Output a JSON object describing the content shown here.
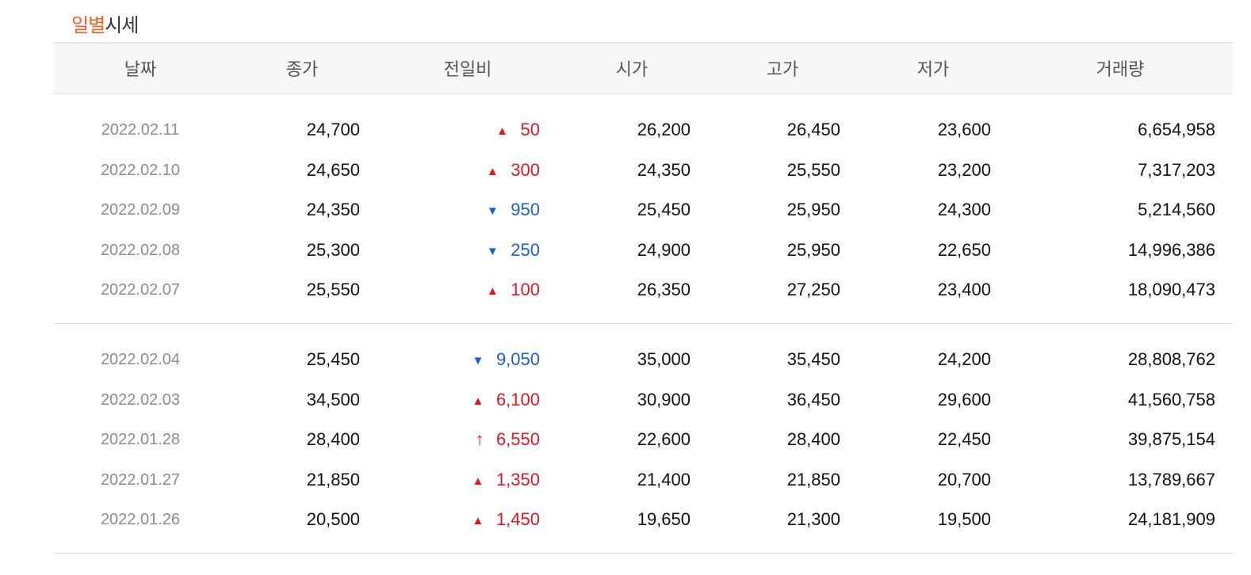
{
  "title": {
    "accent": "일별",
    "rest": "시세"
  },
  "columns": [
    "날짜",
    "종가",
    "전일비",
    "시가",
    "고가",
    "저가",
    "거래량"
  ],
  "groups": [
    [
      {
        "date": "2022.02.11",
        "close": "24,700",
        "dir": "up",
        "icon": "up-triangle-icon",
        "change": "50",
        "open": "26,200",
        "high": "26,450",
        "low": "23,600",
        "volume": "6,654,958"
      },
      {
        "date": "2022.02.10",
        "close": "24,650",
        "dir": "up",
        "icon": "up-triangle-icon",
        "change": "300",
        "open": "24,350",
        "high": "25,550",
        "low": "23,200",
        "volume": "7,317,203"
      },
      {
        "date": "2022.02.09",
        "close": "24,350",
        "dir": "down",
        "icon": "down-triangle-icon",
        "change": "950",
        "open": "25,450",
        "high": "25,950",
        "low": "24,300",
        "volume": "5,214,560"
      },
      {
        "date": "2022.02.08",
        "close": "25,300",
        "dir": "down",
        "icon": "down-triangle-icon",
        "change": "250",
        "open": "24,900",
        "high": "25,950",
        "low": "22,650",
        "volume": "14,996,386"
      },
      {
        "date": "2022.02.07",
        "close": "25,550",
        "dir": "up",
        "icon": "up-triangle-icon",
        "change": "100",
        "open": "26,350",
        "high": "27,250",
        "low": "23,400",
        "volume": "18,090,473"
      }
    ],
    [
      {
        "date": "2022.02.04",
        "close": "25,450",
        "dir": "down",
        "icon": "down-triangle-icon",
        "change": "9,050",
        "open": "35,000",
        "high": "35,450",
        "low": "24,200",
        "volume": "28,808,762"
      },
      {
        "date": "2022.02.03",
        "close": "34,500",
        "dir": "up",
        "icon": "up-triangle-icon",
        "change": "6,100",
        "open": "30,900",
        "high": "36,450",
        "low": "29,600",
        "volume": "41,560,758"
      },
      {
        "date": "2022.01.28",
        "close": "28,400",
        "dir": "up",
        "icon": "upper-limit-arrow-icon",
        "change": "6,550",
        "open": "22,600",
        "high": "28,400",
        "low": "22,450",
        "volume": "39,875,154"
      },
      {
        "date": "2022.01.27",
        "close": "21,850",
        "dir": "up",
        "icon": "up-triangle-icon",
        "change": "1,350",
        "open": "21,400",
        "high": "21,850",
        "low": "20,700",
        "volume": "13,789,667"
      },
      {
        "date": "2022.01.26",
        "close": "20,500",
        "dir": "up",
        "icon": "up-triangle-icon",
        "change": "1,450",
        "open": "19,650",
        "high": "21,300",
        "low": "19,500",
        "volume": "24,181,909"
      }
    ]
  ],
  "colors": {
    "accent": "#ff5a1a",
    "up": "#e8141c",
    "down": "#1a5fd1",
    "date_text": "#8c8c8c",
    "header_bg": "#f7f7f7"
  }
}
